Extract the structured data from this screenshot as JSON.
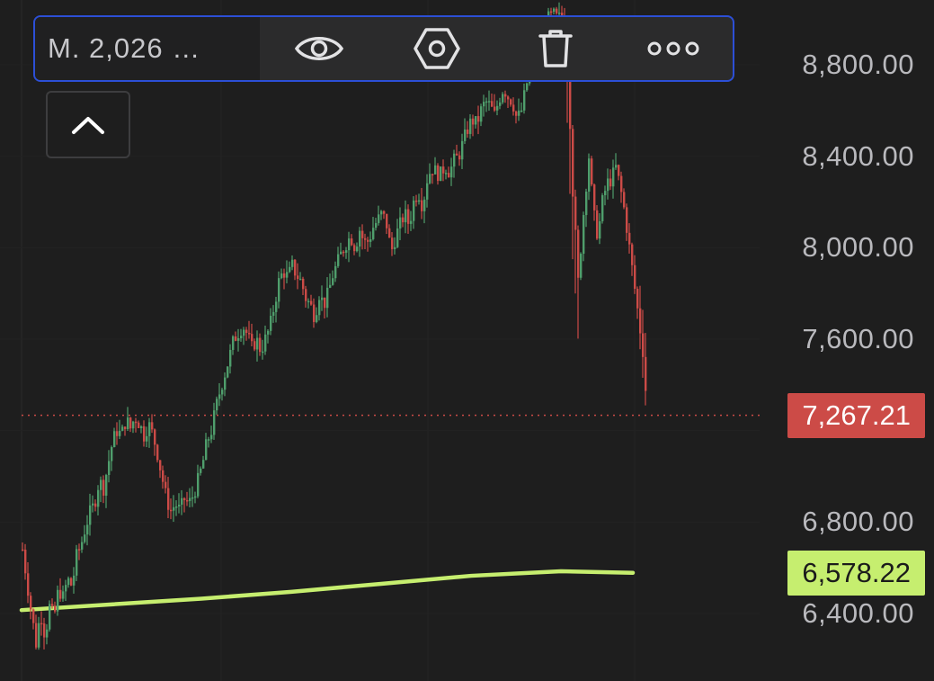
{
  "toolbar": {
    "label": "M. 2,026 …",
    "buttons": [
      {
        "icon": "eye-icon",
        "name": "visibility-button"
      },
      {
        "icon": "settings-hexagon-icon",
        "name": "settings-button"
      },
      {
        "icon": "trash-icon",
        "name": "delete-button"
      },
      {
        "icon": "more-dots-icon",
        "name": "more-button"
      }
    ]
  },
  "collapse_button": {
    "icon": "chevron-up-icon"
  },
  "price_axis": {
    "ticks": [
      "8,800.00",
      "8,400.00",
      "8,000.00",
      "7,600.00",
      "6,800.00",
      "6,400.00"
    ]
  },
  "badges": {
    "last_price": "7,267.21",
    "moving_average": "6,578.22"
  },
  "colors": {
    "background": "#1e1e1e",
    "up_candle": "#4f9e6c",
    "down_candle": "#cc4b47",
    "moving_average": "#c6ee6f",
    "toolbar_border": "#2c4fd6"
  },
  "chart_data": {
    "type": "candlestick",
    "ylim": [
      6300,
      9050
    ],
    "y_ticks": [
      6400,
      6800,
      7600,
      8000,
      8400,
      8800
    ],
    "last_price": 7267.21,
    "moving_average_last": 6578.22,
    "moving_average": [
      [
        0,
        6415
      ],
      [
        100,
        6440
      ],
      [
        200,
        6465
      ],
      [
        300,
        6495
      ],
      [
        400,
        6530
      ],
      [
        500,
        6565
      ],
      [
        600,
        6585
      ],
      [
        680,
        6578.22
      ]
    ],
    "close_path": [
      [
        0,
        6680
      ],
      [
        8,
        6450
      ],
      [
        15,
        6270
      ],
      [
        20,
        6410
      ],
      [
        25,
        6300
      ],
      [
        30,
        6430
      ],
      [
        35,
        6380
      ],
      [
        40,
        6510
      ],
      [
        45,
        6470
      ],
      [
        50,
        6550
      ],
      [
        55,
        6520
      ],
      [
        60,
        6650
      ],
      [
        65,
        6700
      ],
      [
        70,
        6780
      ],
      [
        75,
        6840
      ],
      [
        80,
        6880
      ],
      [
        85,
        6980
      ],
      [
        90,
        6950
      ],
      [
        95,
        7050
      ],
      [
        100,
        7150
      ],
      [
        105,
        7200
      ],
      [
        110,
        7180
      ],
      [
        115,
        7250
      ],
      [
        120,
        7210
      ],
      [
        125,
        7260
      ],
      [
        130,
        7230
      ],
      [
        135,
        7180
      ],
      [
        140,
        7230
      ],
      [
        145,
        7180
      ],
      [
        150,
        7100
      ],
      [
        155,
        7000
      ],
      [
        160,
        6900
      ],
      [
        165,
        6850
      ],
      [
        170,
        6880
      ],
      [
        175,
        6850
      ],
      [
        180,
        6900
      ],
      [
        185,
        6880
      ],
      [
        190,
        6920
      ],
      [
        195,
        6980
      ],
      [
        200,
        7050
      ],
      [
        205,
        7150
      ],
      [
        210,
        7200
      ],
      [
        215,
        7300
      ],
      [
        220,
        7380
      ],
      [
        225,
        7450
      ],
      [
        230,
        7520
      ],
      [
        235,
        7600
      ],
      [
        240,
        7630
      ],
      [
        245,
        7660
      ],
      [
        250,
        7620
      ],
      [
        255,
        7560
      ],
      [
        260,
        7600
      ],
      [
        265,
        7550
      ],
      [
        270,
        7600
      ],
      [
        275,
        7650
      ],
      [
        280,
        7750
      ],
      [
        285,
        7850
      ],
      [
        290,
        7900
      ],
      [
        295,
        7870
      ],
      [
        300,
        7920
      ],
      [
        305,
        7880
      ],
      [
        310,
        7850
      ],
      [
        315,
        7780
      ],
      [
        320,
        7750
      ],
      [
        325,
        7700
      ],
      [
        330,
        7800
      ],
      [
        335,
        7750
      ],
      [
        340,
        7800
      ],
      [
        345,
        7880
      ],
      [
        350,
        7930
      ],
      [
        355,
        7980
      ],
      [
        360,
        8020
      ],
      [
        365,
        8050
      ],
      [
        370,
        8000
      ],
      [
        375,
        8080
      ],
      [
        380,
        8020
      ],
      [
        385,
        8030
      ],
      [
        390,
        8090
      ],
      [
        395,
        8120
      ],
      [
        400,
        8150
      ],
      [
        405,
        8100
      ],
      [
        410,
        7980
      ],
      [
        415,
        8050
      ],
      [
        420,
        8100
      ],
      [
        425,
        8150
      ],
      [
        430,
        8100
      ],
      [
        435,
        8200
      ],
      [
        440,
        8250
      ],
      [
        445,
        8180
      ],
      [
        450,
        8300
      ],
      [
        455,
        8350
      ],
      [
        460,
        8330
      ],
      [
        465,
        8320
      ],
      [
        470,
        8360
      ],
      [
        475,
        8330
      ],
      [
        480,
        8380
      ],
      [
        485,
        8400
      ],
      [
        490,
        8460
      ],
      [
        495,
        8520
      ],
      [
        500,
        8560
      ],
      [
        505,
        8540
      ],
      [
        510,
        8600
      ],
      [
        515,
        8640
      ],
      [
        520,
        8620
      ],
      [
        525,
        8580
      ],
      [
        530,
        8650
      ],
      [
        535,
        8700
      ],
      [
        540,
        8660
      ],
      [
        545,
        8640
      ],
      [
        550,
        8560
      ],
      [
        555,
        8600
      ],
      [
        560,
        8700
      ],
      [
        565,
        8800
      ],
      [
        570,
        8850
      ],
      [
        575,
        8900
      ],
      [
        580,
        8950
      ],
      [
        585,
        9000
      ],
      [
        590,
        9020
      ],
      [
        595,
        9000
      ],
      [
        600,
        9010
      ],
      [
        605,
        8960
      ],
      [
        612,
        8250
      ],
      [
        618,
        7850
      ],
      [
        625,
        8200
      ],
      [
        630,
        8400
      ],
      [
        635,
        8150
      ],
      [
        640,
        8050
      ],
      [
        645,
        8200
      ],
      [
        650,
        8280
      ],
      [
        655,
        8300
      ],
      [
        660,
        8350
      ],
      [
        665,
        8260
      ],
      [
        670,
        8150
      ],
      [
        675,
        8000
      ],
      [
        680,
        7850
      ],
      [
        685,
        7700
      ],
      [
        690,
        7550
      ],
      [
        695,
        7267.21
      ]
    ]
  }
}
